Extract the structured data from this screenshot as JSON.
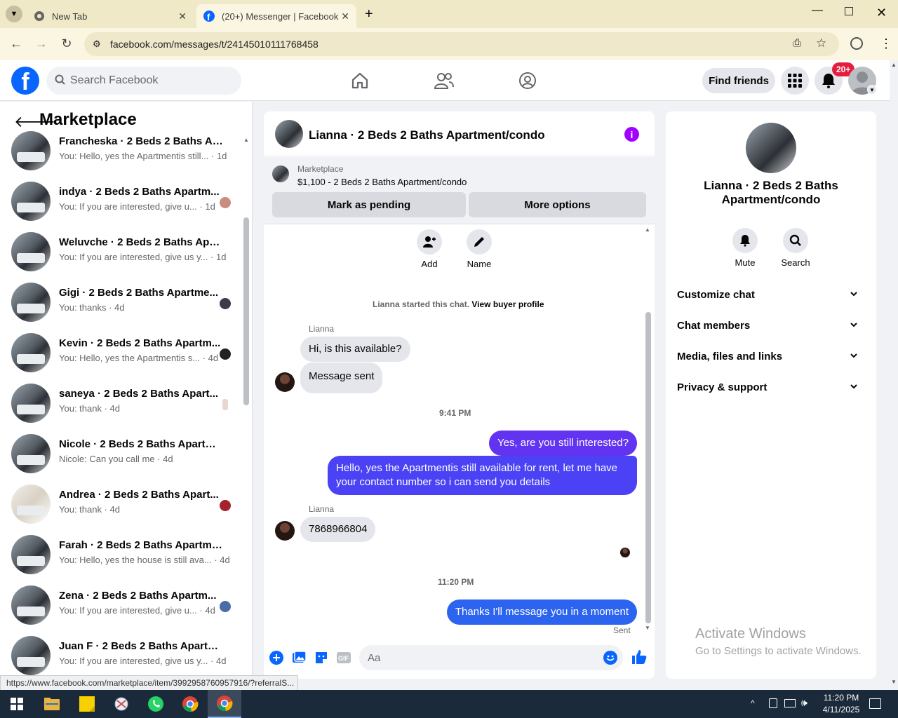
{
  "browser": {
    "tabs": [
      {
        "label": "New Tab"
      },
      {
        "label": "(20+) Messenger | Facebook"
      }
    ],
    "url": "facebook.com/messages/t/24145010111768458",
    "status_url": "https://www.facebook.com/marketplace/item/3992958760957916/?referralS..."
  },
  "header": {
    "search_placeholder": "Search Facebook",
    "find_friends": "Find friends",
    "notification_badge": "20+"
  },
  "sidebar": {
    "title": "Marketplace",
    "conversations": [
      {
        "name": "Francheska · 2 Beds 2 Baths Apa...",
        "snippet": "You: Hello, yes the Apartmentis still... · 1d"
      },
      {
        "name": "indya · 2 Beds 2 Baths Apartm...",
        "snippet": "You: If you are interested, give u... · 1d"
      },
      {
        "name": "Weluvche · 2 Beds 2 Baths Apart...",
        "snippet": "You: If you are interested, give us y... · 1d"
      },
      {
        "name": "Gigi · 2 Beds 2 Baths Apartme...",
        "snippet": "You: thanks · 4d"
      },
      {
        "name": "Kevin · 2 Beds 2 Baths Apartm...",
        "snippet": "You: Hello, yes the Apartmentis s... · 4d"
      },
      {
        "name": "saneya · 2 Beds 2 Baths Apart...",
        "snippet": "You: thank · 4d"
      },
      {
        "name": "Nicole · 2 Beds 2 Baths Apartme...",
        "snippet": "Nicole: Can you call me · 4d"
      },
      {
        "name": "Andrea · 2 Beds 2 Baths Apart...",
        "snippet": "You: thank · 4d"
      },
      {
        "name": "Farah · 2 Beds 2 Baths Apartmen...",
        "snippet": "You: Hello, yes the house is still ava... · 4d"
      },
      {
        "name": "Zena · 2 Beds 2 Baths Apartm...",
        "snippet": "You: If you are interested, give u... · 4d"
      },
      {
        "name": "Juan F · 2 Beds 2 Baths Apartme...",
        "snippet": "You: If you are interested, give us y... · 4d"
      }
    ]
  },
  "chat": {
    "title": "Lianna · 2 Beds 2 Baths Apartment/condo",
    "listing_label": "Marketplace",
    "listing_price": "$1,100 - 2 Beds 2 Baths Apartment/condo",
    "mark_pending": "Mark as pending",
    "more_options": "More options",
    "add_label": "Add",
    "name_label": "Name",
    "started_text": "Lianna started this chat.",
    "view_profile": "View buyer profile",
    "sender_name": "Lianna",
    "msg1": "Hi, is this available?",
    "msg2": "Message sent",
    "time1": "9:41 PM",
    "out1": "Yes, are you still interested?",
    "out2": "Hello, yes the Apartmentis still available for rent, let me have your contact number so i can send you  details",
    "msg3": "7868966804",
    "time2": "11:20 PM",
    "out3": "Thanks I'll message you in a moment",
    "sent": "Sent",
    "composer_placeholder": "Aa"
  },
  "details": {
    "name": "Lianna · 2 Beds 2 Baths Apartment/condo",
    "mute": "Mute",
    "search": "Search",
    "sections": [
      "Customize chat",
      "Chat members",
      "Media, files and links",
      "Privacy & support"
    ]
  },
  "watermark": {
    "line1": "Activate Windows",
    "line2": "Go to Settings to activate Windows."
  },
  "taskbar": {
    "time": "11:20 PM",
    "date": "4/11/2025"
  },
  "colors": {
    "fb_blue": "#0866ff",
    "outgoing": "#5b35f5",
    "info": "#a100ff"
  }
}
